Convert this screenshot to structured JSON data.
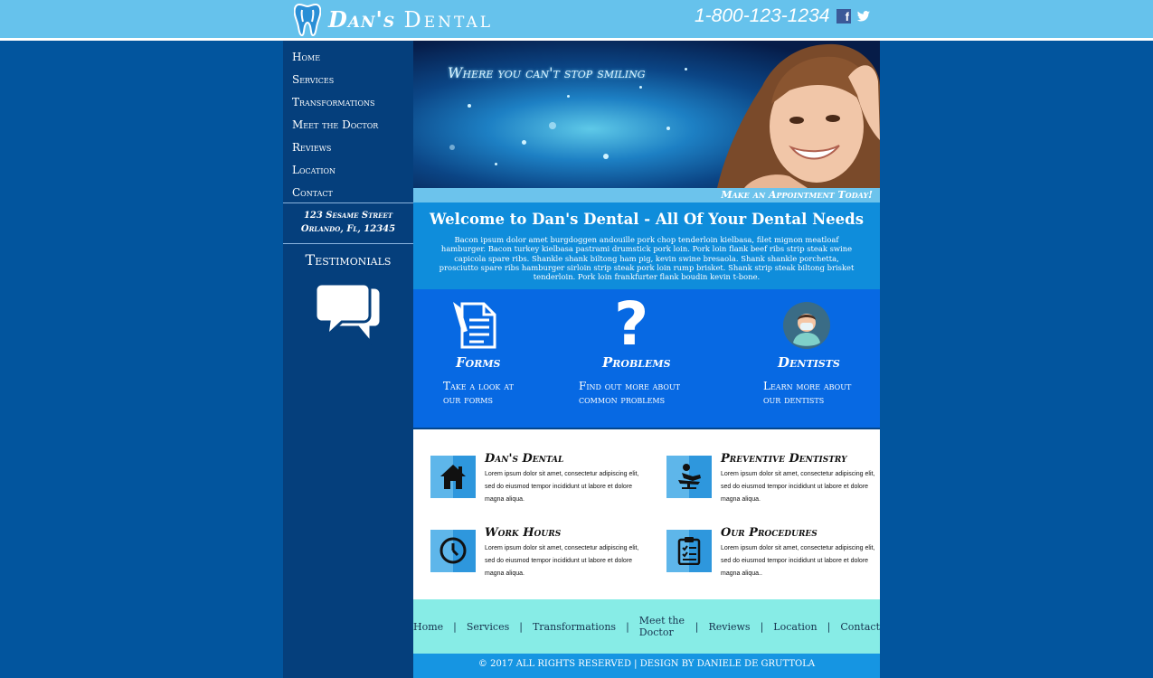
{
  "header": {
    "logo_brand_first": "Dan's",
    "logo_brand_second": "Dental",
    "phone": "1-800-123-1234",
    "facebook_icon": "facebook-icon",
    "twitter_icon": "twitter-icon",
    "logo_icon": "tooth-icon"
  },
  "sidebar": {
    "nav": [
      {
        "label": "Home"
      },
      {
        "label": "Services"
      },
      {
        "label": "Transformations"
      },
      {
        "label": "Meet the Doctor"
      },
      {
        "label": "Reviews"
      },
      {
        "label": "Location"
      },
      {
        "label": "Contact"
      }
    ],
    "address_line1": "123 Sesame Street",
    "address_line2": "Orlando, Fl, 12345",
    "testimonials_title": "Testimonials",
    "testimonials_icon": "speech-bubbles-icon"
  },
  "hero": {
    "tagline": "Where you can't stop smiling",
    "appointment_label": "Make an Appointment Today!"
  },
  "welcome": {
    "title": "Welcome to Dan's Dental - All Of Your Dental Needs",
    "body": "Bacon ipsum dolor amet burgdoggen andouille pork chop tenderloin kielbasa, filet mignon meatloaf hamburger. Bacon turkey kielbasa pastrami drumstick pork loin. Pork loin flank beef ribs strip steak swine capicola spare ribs. Shankle shank biltong ham pig, kevin swine bresaola. Shank shankle porchetta, prosciutto spare ribs hamburger sirloin strip steak pork loin rump brisket. Shank strip steak biltong brisket tenderloin. Pork loin frankfurter flank boudin kevin t-bone."
  },
  "services": [
    {
      "title": "Forms",
      "desc": "Take a look at\nour forms",
      "icon": "document-icon"
    },
    {
      "title": "Problems",
      "desc": "Find out more about\ncommon problems",
      "icon": "question-mark-icon"
    },
    {
      "title": "Dentists",
      "desc": "Learn more about\nour dentists",
      "icon": "dentist-avatar-icon"
    }
  ],
  "features": [
    {
      "title": "Dan's Dental",
      "body": "Lorem ipsum dolor sit amet, consectetur adipiscing elit, sed do eiusmod tempor incididunt ut labore et dolore magna aliqua.",
      "icon": "house-icon"
    },
    {
      "title": "Preventive Dentistry",
      "body": "Lorem ipsum dolor sit amet, consectetur adipiscing elit, sed do eiusmod tempor incididunt ut labore et dolore magna aliqua.",
      "icon": "dental-chair-icon"
    },
    {
      "title": "Work Hours",
      "body": "Lorem ipsum dolor sit amet, consectetur adipiscing elit, sed do eiusmod tempor incididunt ut labore et dolore magna aliqua.",
      "icon": "clock-icon"
    },
    {
      "title": "Our Procedures",
      "body": "Lorem ipsum dolor sit amet, consectetur adipiscing elit, sed do eiusmod tempor incididunt ut labore et dolore magna aliqua..",
      "icon": "clipboard-checklist-icon"
    }
  ],
  "footer": {
    "nav": [
      {
        "label": "Home"
      },
      {
        "label": "Services"
      },
      {
        "label": "Transformations"
      },
      {
        "label": "Meet the Doctor"
      },
      {
        "label": "Reviews"
      },
      {
        "label": "Location"
      },
      {
        "label": "Contact"
      }
    ],
    "separator": "|",
    "copyright": "© 2017 ALL RIGHTS RESERVED | DESIGN BY DANIELE DE GRUTTOLA"
  },
  "colors": {
    "page_bg": "#02559e",
    "header_bg": "#66c2ec",
    "sidebar_bg": "#053f7c",
    "welcome_bg": "#0f8ddb",
    "services_bg": "#0769e3",
    "footer_nav_bg": "#87ece6",
    "copyright_bg": "#1695e2"
  }
}
